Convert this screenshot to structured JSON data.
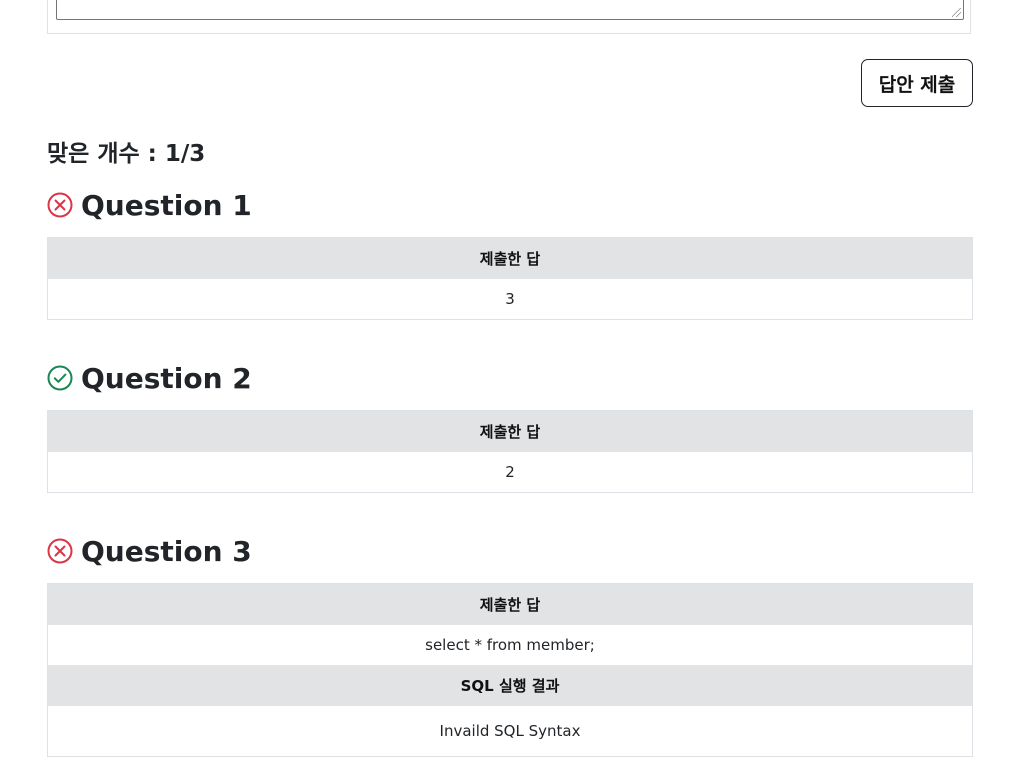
{
  "actions": {
    "submit_label": "답안 제출"
  },
  "result": {
    "score_text": "맞은 개수 : 1/3"
  },
  "questions": [
    {
      "title": "Question 1",
      "status": "incorrect",
      "status_icon": "x-circle-icon",
      "answer_header": "제출한 답",
      "answer_value": "3"
    },
    {
      "title": "Question 2",
      "status": "correct",
      "status_icon": "check-circle-icon",
      "answer_header": "제출한 답",
      "answer_value": "2"
    },
    {
      "title": "Question 3",
      "status": "incorrect",
      "status_icon": "x-circle-icon",
      "answer_header": "제출한 답",
      "answer_value": "select * from member;",
      "sql_result_header": "SQL 실행 결과",
      "sql_result_value": "Invaild SQL Syntax"
    }
  ],
  "colors": {
    "incorrect": "#dc3545",
    "correct": "#198754",
    "header_bg": "#e2e3e5",
    "border": "#dee2e6"
  }
}
